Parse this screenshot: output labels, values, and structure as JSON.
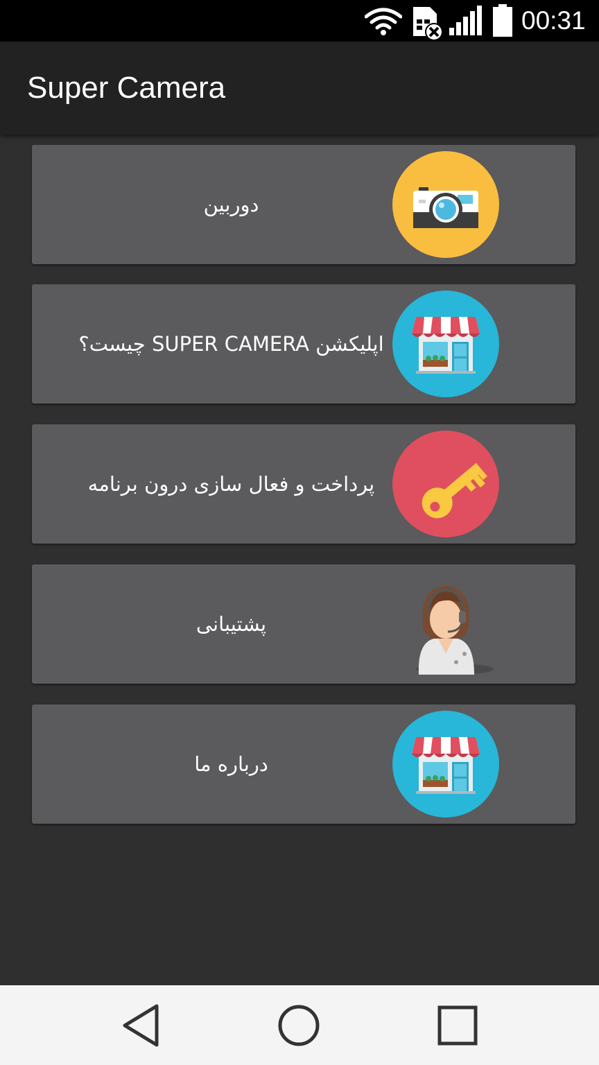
{
  "status_bar": {
    "time": "00:31",
    "icons": [
      "wifi-icon",
      "sim-card-missing-icon",
      "signal-icon",
      "battery-icon"
    ]
  },
  "app_bar": {
    "title": "Super Camera"
  },
  "menu": {
    "items": [
      {
        "label": "دوربین",
        "icon": "camera-icon",
        "icon_bg": "#f9be3f"
      },
      {
        "label": "اپلیکشن SUPER CAMERA چیست؟",
        "icon": "store-icon",
        "icon_bg": "#28b6d9"
      },
      {
        "label": "پرداخت و فعال سازی درون برنامه",
        "icon": "key-icon",
        "icon_bg": "#e04f5f"
      },
      {
        "label": "پشتیبانی",
        "icon": "support-agent-icon",
        "icon_bg": ""
      },
      {
        "label": "درباره ما",
        "icon": "store-icon",
        "icon_bg": "#28b6d9"
      }
    ]
  },
  "nav_bar": {
    "buttons": [
      "back-icon",
      "home-icon",
      "recents-icon"
    ]
  },
  "colors": {
    "background": "#2f2f2f",
    "app_bar": "#222222",
    "card": "#5b5a5c",
    "nav_bar": "#f4f4f4"
  }
}
